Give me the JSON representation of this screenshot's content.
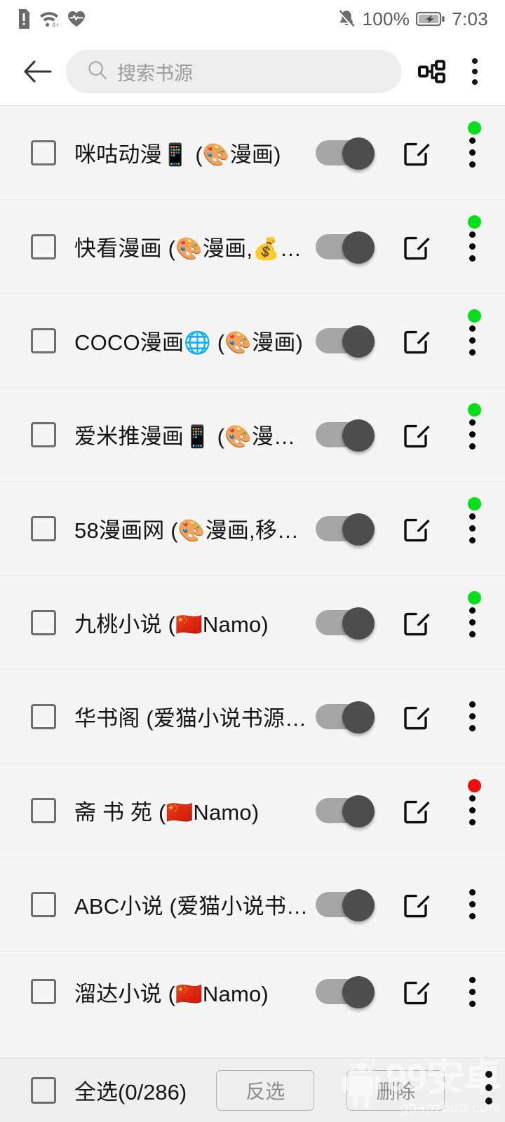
{
  "status_bar": {
    "left_icons": [
      "sim-alert-icon",
      "wifi-icon",
      "heart-rate-icon"
    ],
    "mute_icon": "bell-muted-icon",
    "battery_percent": "100%",
    "battery_icon": "battery-charging-icon",
    "time": "7:03"
  },
  "toolbar": {
    "back_icon": "back-arrow-icon",
    "search_placeholder": "搜索书源",
    "search_value": "",
    "search_icon": "search-icon",
    "group_icon": "source-group-icon",
    "overflow_icon": "kebab-menu-icon"
  },
  "colors": {
    "status_green": "#00e01a",
    "status_red": "#f40c0c",
    "toggle_track": "#a6a6a6",
    "toggle_thumb": "#4d4d4d",
    "list_bg": "#f5f5f5",
    "header_bg": "#ffffff",
    "bottom_bg": "#efefef"
  },
  "list": {
    "rows": [
      {
        "label": "咪咕动漫📱 (🎨漫画)",
        "checked": false,
        "enabled": true,
        "status": "green"
      },
      {
        "label": "快看漫画 (🎨漫画,💰…",
        "checked": false,
        "enabled": true,
        "status": "green"
      },
      {
        "label": "COCO漫画🌐 (🎨漫画)",
        "checked": false,
        "enabled": true,
        "status": "green"
      },
      {
        "label": "爱米推漫画📱 (🎨漫…",
        "checked": false,
        "enabled": true,
        "status": "green"
      },
      {
        "label": "58漫画网 (🎨漫画,移…",
        "checked": false,
        "enabled": true,
        "status": "green"
      },
      {
        "label": "九桃小说 (🇨🇳Namo)",
        "checked": false,
        "enabled": true,
        "status": "green"
      },
      {
        "label": "华书阁 (爱猫小说书源…",
        "checked": false,
        "enabled": true,
        "status": "none"
      },
      {
        "label": "斋 书 苑 (🇨🇳Namo)",
        "checked": false,
        "enabled": true,
        "status": "red"
      },
      {
        "label": "ABC小说 (爱猫小说书…",
        "checked": false,
        "enabled": true,
        "status": "none"
      },
      {
        "label": "溜达小说 (🇨🇳Namo)",
        "checked": false,
        "enabled": true,
        "status": "none"
      }
    ]
  },
  "bottom_bar": {
    "select_all_label": "全选(0/286)",
    "select_all_checked": false,
    "invert_label": "反选",
    "delete_label": "删除",
    "overflow_icon": "kebab-menu-icon"
  },
  "watermark": {
    "logo_icon": "android-robot-icon",
    "big_text": "99安卓",
    "small_text": "ggapzhuo.com"
  }
}
